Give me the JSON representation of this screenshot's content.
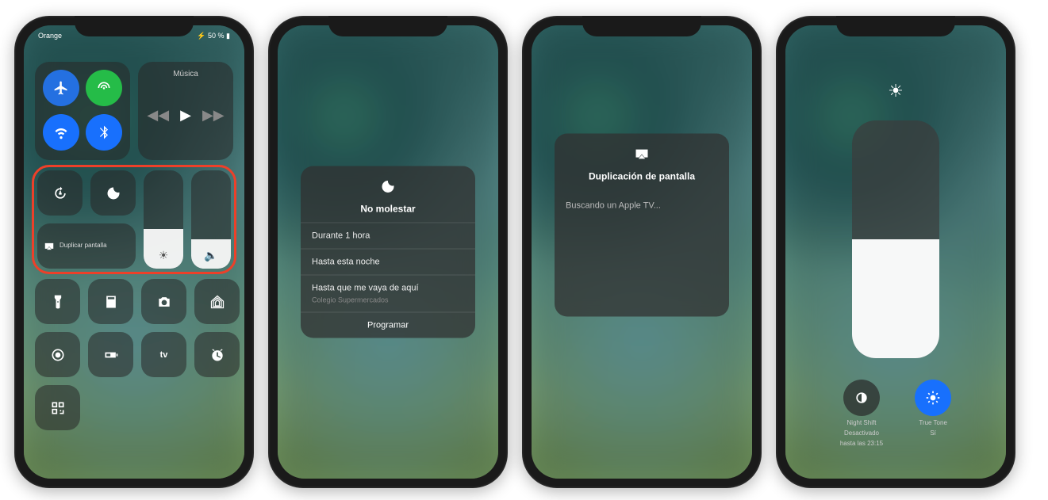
{
  "status": {
    "carrier": "Orange",
    "battery": "50 %"
  },
  "music": {
    "label": "Música"
  },
  "mirror": {
    "label": "Duplicar pantalla"
  },
  "sliders": {
    "brightness_pct": 40,
    "volume_pct": 30
  },
  "dnd_panel": {
    "title": "No molestar",
    "options": [
      "Durante 1 hora",
      "Hasta esta noche",
      "Hasta que me vaya de aquí"
    ],
    "sub": "Colegio Supermercados",
    "footer": "Programar"
  },
  "mirror_panel": {
    "title": "Duplicación de pantalla",
    "searching": "Buscando un Apple TV..."
  },
  "brightness_panel": {
    "level_pct": 50,
    "night_shift": {
      "label": "Night Shift",
      "status1": "Desactivado",
      "status2": "hasta las 23:15"
    },
    "true_tone": {
      "label": "True Tone",
      "status": "Sí"
    }
  },
  "icons": {
    "airplane": "airplane",
    "cellular": "cellular",
    "wifi": "wifi",
    "bluetooth": "bluetooth",
    "lock": "orientation-lock",
    "moon": "do-not-disturb",
    "mirror": "screen-mirroring",
    "brightness": "brightness",
    "volume": "volume",
    "flashlight": "flashlight",
    "calculator": "calculator",
    "camera": "camera",
    "home": "home",
    "record": "screen-record",
    "lowpower": "low-power",
    "appletv": "apple-tv-remote",
    "alarm": "alarm",
    "qr": "qr-scanner"
  },
  "colors": {
    "highlight": "#e0432e",
    "toggle_blue": "#1f6fef",
    "toggle_green": "#2fb84f"
  }
}
